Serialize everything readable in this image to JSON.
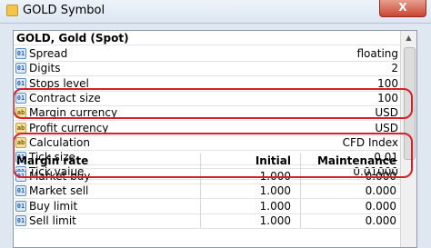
{
  "window": {
    "title": "GOLD Symbol",
    "close_label": "X"
  },
  "symbol_title": "GOLD, Gold (Spot)",
  "properties": [
    {
      "icon": "01",
      "label": "Spread",
      "value": "floating"
    },
    {
      "icon": "01",
      "label": "Digits",
      "value": "2"
    },
    {
      "icon": "01",
      "label": "Stops level",
      "value": "100"
    },
    {
      "icon": "01",
      "label": "Contract size",
      "value": "100"
    },
    {
      "icon": "ab",
      "label": "Margin currency",
      "value": "USD"
    },
    {
      "icon": "ab",
      "label": "Profit currency",
      "value": "USD"
    },
    {
      "icon": "ab",
      "label": "Calculation",
      "value": "CFD Index"
    },
    {
      "icon": "01",
      "label": "Tick size",
      "value": "0.01"
    },
    {
      "icon": "01",
      "label": "Tick value",
      "value": "0.01000"
    }
  ],
  "margin_header": {
    "label": "Margin rate",
    "initial": "Initial",
    "maintenance": "Maintenance"
  },
  "margin_rows": [
    {
      "icon": "01",
      "label": "Market buy",
      "initial": "1.000",
      "maintenance": "0.000"
    },
    {
      "icon": "01",
      "label": "Market sell",
      "initial": "1.000",
      "maintenance": "0.000"
    },
    {
      "icon": "01",
      "label": "Buy limit",
      "initial": "1.000",
      "maintenance": "0.000"
    },
    {
      "icon": "01",
      "label": "Sell limit",
      "initial": "1.000",
      "maintenance": "0.000"
    }
  ],
  "colors": {
    "highlight": "#d61f28",
    "panel_bg": "#ffffff",
    "window_bg": "#dfe7f1"
  }
}
